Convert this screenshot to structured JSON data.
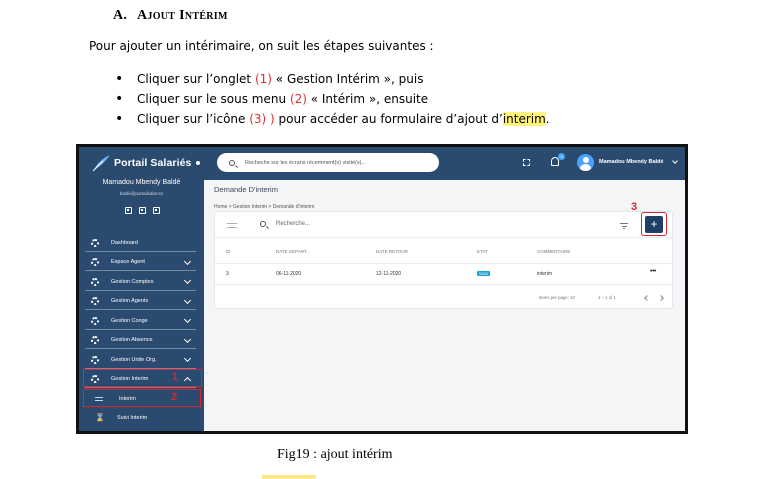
{
  "document": {
    "heading_num": "A.",
    "heading_text": "Ajout Intérim",
    "intro": "Pour ajouter un intérimaire, on suit les étapes suivantes :",
    "steps": [
      {
        "before": "Cliquer sur l’onglet ",
        "marker": "(1)",
        "after": " « Gestion Intérim », puis"
      },
      {
        "before": "Cliquer sur le sous menu ",
        "marker": "(2)",
        "after": " « Intérim », ensuite"
      },
      {
        "before": "Cliquer sur l’icône ",
        "marker": "(3) )",
        "after_a": " pour accéder au formulaire d’ajout d’",
        "highlight": "interim",
        "after_b": "."
      }
    ],
    "caption": "Fig19 : ajout intérim"
  },
  "app": {
    "brand": "Portail Salariés",
    "user_name": "Mamadou Mbendy Baldé",
    "user_email": "baldé@portailsalar.sn",
    "search_placeholder": "Recheche sur les écrans récemment(s) visité(s)...",
    "notification_count": "3",
    "top_user": "Mamadou Mbendy Baldé",
    "nav": [
      {
        "label": "Dashboard"
      },
      {
        "label": "Espace Agent"
      },
      {
        "label": "Gestion Comptes"
      },
      {
        "label": "Gestion Agents"
      },
      {
        "label": "Gestion Conge"
      },
      {
        "label": "Gestion Absence"
      },
      {
        "label": "Gestion Unite Org."
      },
      {
        "label": "Gestion Interim"
      }
    ],
    "subnav": [
      {
        "label": "Interim"
      },
      {
        "label": "Suivi Interim"
      }
    ],
    "page_title": "Demande D'interim",
    "breadcrumb": {
      "home": "Home",
      "sep": ">",
      "section": "Gestion Interim",
      "page": "Demande d'interim"
    },
    "table_search": "Recherche...",
    "add_label": "+",
    "columns": [
      "ID",
      "DATE DEPART",
      "DATE RETOUR",
      "ETAT",
      "COMMENTAIRE"
    ],
    "rows": [
      {
        "id": "3",
        "depart": "06-11-2020",
        "retour": "12-11-2020",
        "etat": "SAISI",
        "commentaire": "interim",
        "more": "•••"
      }
    ],
    "pager": {
      "items_label": "Items per page: 10",
      "range": "1 – 1 of 1"
    }
  },
  "annotations": {
    "one": "1",
    "two": "2",
    "three": "3"
  },
  "colors": {
    "sidebar": "#2b4a6f",
    "accent_red": "#d9262b",
    "add_button": "#1e3f68",
    "badge": "#1fa2d6"
  }
}
